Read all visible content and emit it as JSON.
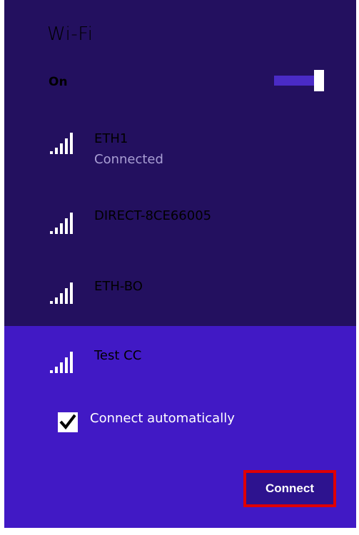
{
  "wifi": {
    "title": "Wi-Fi",
    "status_label": "On",
    "toggle_state": "on",
    "networks": [
      {
        "name": "ETH1",
        "status": "Connected",
        "icon": "wifi-signal-icon"
      },
      {
        "name": "DIRECT-8CE66005",
        "icon": "wifi-signal-icon"
      },
      {
        "name": "ETH-BO",
        "icon": "wifi-signal-icon"
      },
      {
        "name": "Test CC",
        "icon": "wifi-signal-icon",
        "selected": true
      }
    ],
    "connect_automatically": {
      "label": "Connect automatically",
      "checked": true
    },
    "connect_button": "Connect"
  },
  "colors": {
    "panel_bg": "#23105f",
    "selected_bg": "#4119c5",
    "toggle_track": "#4a2bc6",
    "highlight_border": "#e00000"
  }
}
